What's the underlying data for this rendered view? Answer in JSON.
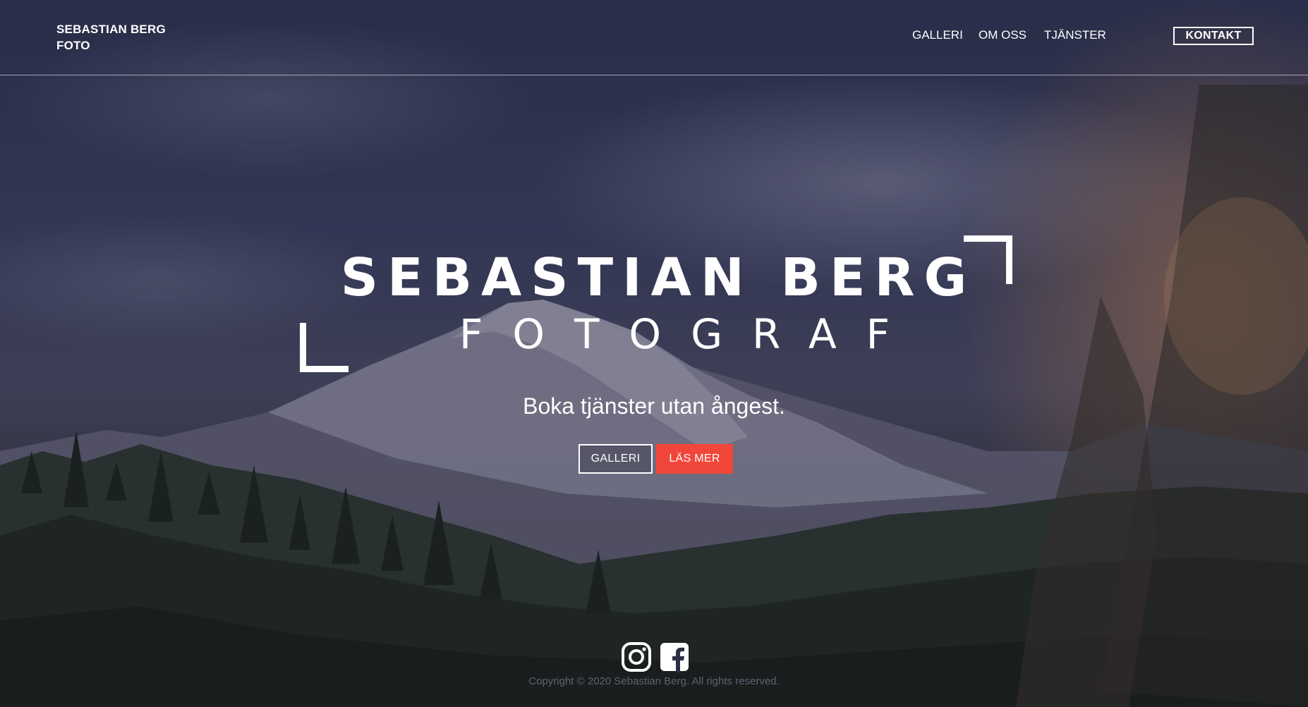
{
  "brand": {
    "line1": "SEBASTIAN BERG",
    "line2": "FOTO"
  },
  "nav": {
    "items": [
      {
        "label": "GALLERI"
      },
      {
        "label": "OM OSS"
      },
      {
        "label": "TJÄNSTER"
      }
    ],
    "contact_label": "KONTAKT"
  },
  "hero": {
    "title": "SEBASTIAN BERG",
    "subtitle": "FOTOGRAF",
    "tagline": "Boka tjänster utan ångest.",
    "gallery_button": "GALLERI",
    "more_button": "LÄS MER",
    "more_button_color": "#f1463a"
  },
  "social": [
    {
      "icon": "instagram-icon"
    },
    {
      "icon": "facebook-icon"
    }
  ],
  "footer": {
    "copyright": "Copyright © 2020 Sebastian Berg. All rights reserved."
  }
}
